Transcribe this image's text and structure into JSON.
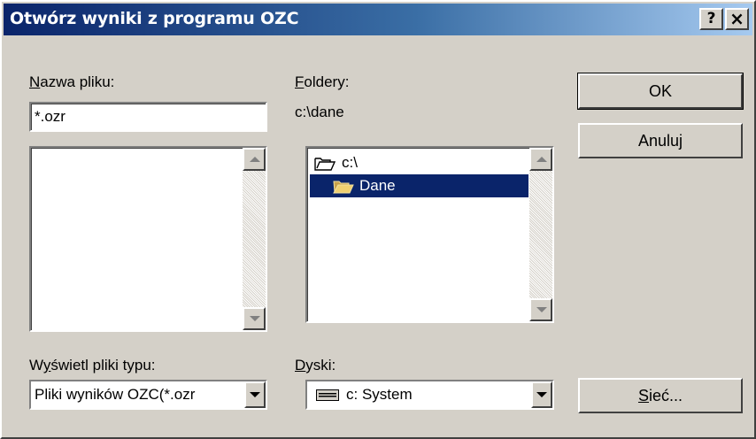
{
  "window": {
    "title": "Otwórz wyniki z programu OZC",
    "help_label": "?",
    "close_label": "×"
  },
  "filename": {
    "label_u": "N",
    "label_rest": "azwa pliku:",
    "value": "*.ozr"
  },
  "folders": {
    "label_u": "F",
    "label_rest": "oldery:",
    "current_path": "c:\\dane",
    "items": [
      {
        "label": "c:\\",
        "icon": "open-folder-icon",
        "selected": false
      },
      {
        "label": "Dane",
        "icon": "open-folder-icon",
        "selected": true
      }
    ]
  },
  "filetype": {
    "label_pre": "W",
    "label_u": "y",
    "label_rest": "świetl pliki typu:",
    "value": "Pliki wyników OZC(*.ozr"
  },
  "drives": {
    "label_u": "D",
    "label_rest": "yski:",
    "value": "c: System",
    "icon": "hard-drive-icon"
  },
  "buttons": {
    "ok": "OK",
    "cancel": "Anuluj",
    "network_u": "S",
    "network_rest": "ieć..."
  },
  "colors": {
    "titlebar_start": "#0a246a",
    "titlebar_end": "#a6caf0",
    "face": "#d4d0c8",
    "selection": "#0a246a"
  }
}
